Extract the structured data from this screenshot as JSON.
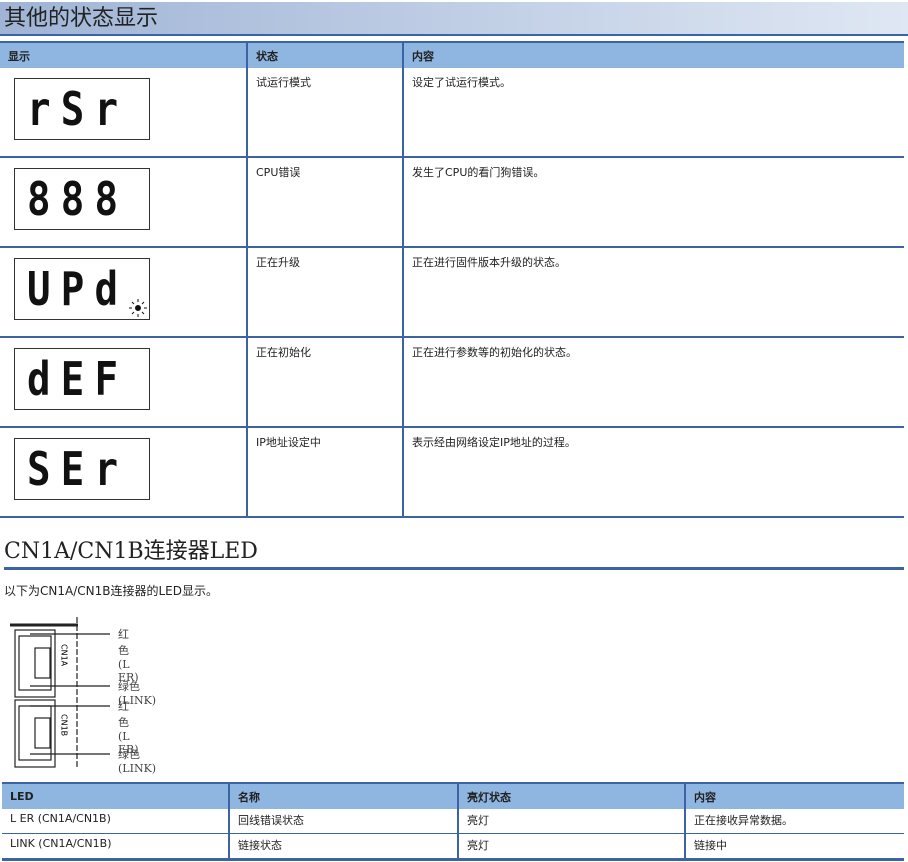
{
  "section1": {
    "title": "其他的状态显示",
    "headers": [
      "显示",
      "状态",
      "内容"
    ],
    "rows": [
      {
        "display": "rSr",
        "status": "试运行模式",
        "content": "设定了试运行模式。"
      },
      {
        "display": "888",
        "status": "CPU错误",
        "content": "发生了CPU的看门狗错误。"
      },
      {
        "display": "UPd",
        "blink_dot": true,
        "status": "正在升级",
        "content": "正在进行固件版本升级的状态。"
      },
      {
        "display": "dEF",
        "status": "正在初始化",
        "content": "正在进行参数等的初始化的状态。"
      },
      {
        "display": "SEr",
        "status": "IP地址设定中",
        "content": "表示经由网络设定IP地址的过程。"
      }
    ]
  },
  "section2": {
    "title": "CN1A/CN1B连接器LED",
    "intro": "以下为CN1A/CN1B连接器的LED显示。",
    "diagram": {
      "port_a": "CN1A",
      "port_b": "CN1B",
      "labels": [
        "红色 (L ER)",
        "绿色 (LINK)",
        "红色 (L ER)",
        "绿色 (LINK)"
      ]
    },
    "headers": [
      "LED",
      "名称",
      "亮灯状态",
      "内容"
    ],
    "rows": [
      [
        "L ER (CN1A/CN1B)",
        "回线错误状态",
        "亮灯",
        "正在接收异常数据。"
      ],
      [
        "LINK (CN1A/CN1B)",
        "链接状态",
        "亮灯",
        "链接中"
      ]
    ]
  },
  "colors": {
    "accent": "#3c63a3",
    "header_bg": "#8fb6e0"
  }
}
